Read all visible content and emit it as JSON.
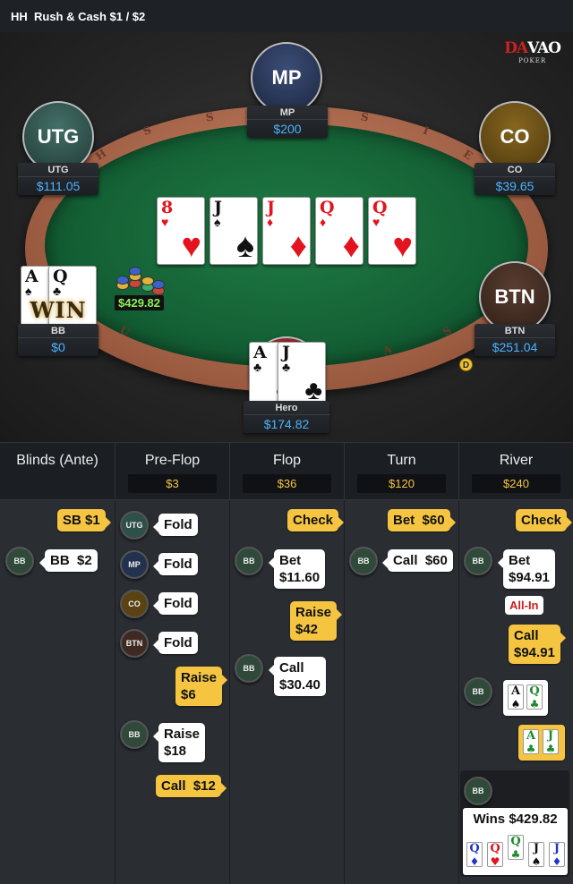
{
  "header": {
    "title": "HH  Rush & Cash $1 / $2"
  },
  "logo": {
    "brand_a": "DA",
    "brand_b": "VAO",
    "sub": "POKER"
  },
  "rail_letters": [
    "S",
    "S",
    "U",
    "S",
    "A",
    "S",
    "H",
    "S",
    "I",
    "S",
    "E"
  ],
  "seats": [
    {
      "pos": "MP",
      "name": "MP",
      "stack": "$200",
      "color": "#23314f"
    },
    {
      "pos": "UTG",
      "name": "UTG",
      "stack": "$111.05",
      "color": "#2f4f49"
    },
    {
      "pos": "CO",
      "name": "CO",
      "stack": "$39.65",
      "color": "#5a4212"
    },
    {
      "pos": "BTN",
      "name": "BTN",
      "stack": "$251.04",
      "color": "#3e2a22"
    },
    {
      "pos": "BB",
      "name": "BB",
      "stack": "$0"
    },
    {
      "pos": "Hero",
      "name": "Hero",
      "stack": "$174.82"
    }
  ],
  "board": [
    {
      "rank": "8",
      "suit": "♥",
      "color": "red"
    },
    {
      "rank": "J",
      "suit": "♠",
      "color": "blk"
    },
    {
      "rank": "J",
      "suit": "♦",
      "color": "red"
    },
    {
      "rank": "Q",
      "suit": "♦",
      "color": "red"
    },
    {
      "rank": "Q",
      "suit": "♥",
      "color": "red"
    }
  ],
  "bb_cards": [
    {
      "rank": "A",
      "suit": "♠",
      "color": "blk"
    },
    {
      "rank": "Q",
      "suit": "♣",
      "color": "blk"
    }
  ],
  "hero_cards": [
    {
      "rank": "A",
      "suit": "♣",
      "color": "blk"
    },
    {
      "rank": "J",
      "suit": "♣",
      "color": "blk"
    }
  ],
  "win_text": "WIN",
  "pot": "$429.82",
  "dealer_label": "D",
  "streets": [
    {
      "name": "Blinds (Ante)",
      "pot": ""
    },
    {
      "name": "Pre-Flop",
      "pot": "$3"
    },
    {
      "name": "Flop",
      "pot": "$36"
    },
    {
      "name": "Turn",
      "pot": "$120"
    },
    {
      "name": "River",
      "pot": "$240"
    }
  ],
  "actions": {
    "blinds": {
      "sb": "SB  $1",
      "bb": "BB  $2"
    },
    "preflop": {
      "utg": "Fold",
      "mp": "Fold",
      "co": "Fold",
      "btn": "Fold",
      "hero_raise": "Raise\n$6",
      "bb_raise": "Raise\n$18",
      "hero_call": "Call  $12"
    },
    "flop": {
      "hero_check": "Check",
      "bb_bet": "Bet\n$11.60",
      "hero_raise": "Raise\n$42",
      "bb_call": "Call\n$30.40"
    },
    "turn": {
      "hero_bet": "Bet  $60",
      "bb_call": "Call  $60"
    },
    "river": {
      "hero_check": "Check",
      "bb_bet": "Bet\n$94.91",
      "allin": "All-In",
      "hero_call": "Call\n$94.91"
    }
  },
  "avatars": {
    "utg": "UTG",
    "mp": "MP",
    "co": "CO",
    "btn": "BTN",
    "bb": "BB"
  },
  "showdown": {
    "bb_cards": [
      {
        "rank": "A",
        "suit": "♠",
        "color": "blk"
      },
      {
        "rank": "Q",
        "suit": "♣",
        "color": "grn"
      }
    ],
    "hero_cards": [
      {
        "rank": "A",
        "suit": "♣",
        "color": "grn"
      },
      {
        "rank": "J",
        "suit": "♣",
        "color": "grn"
      }
    ],
    "win_title": "Wins $429.82",
    "win_cards": [
      {
        "rank": "Q",
        "suit": "♦",
        "color": "blu"
      },
      {
        "rank": "Q",
        "suit": "♥",
        "color": "red"
      },
      {
        "rank": "Q",
        "suit": "♣",
        "color": "grn"
      },
      {
        "rank": "J",
        "suit": "♠",
        "color": "blk"
      },
      {
        "rank": "J",
        "suit": "♦",
        "color": "blu"
      }
    ]
  },
  "colors": {
    "accent": "#f5c542",
    "stack": "#4cb3ff",
    "pot": "#8ef25c",
    "felt": "#146035"
  }
}
